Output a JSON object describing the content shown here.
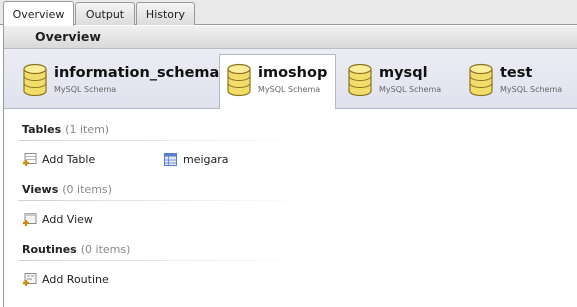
{
  "tabs": [
    {
      "label": "Overview",
      "active": true
    },
    {
      "label": "Output",
      "active": false
    },
    {
      "label": "History",
      "active": false
    }
  ],
  "overview": {
    "title": "Overview"
  },
  "schemas": [
    {
      "name": "information_schema",
      "kind": "MySQL Schema",
      "selected": false
    },
    {
      "name": "imoshop",
      "kind": "MySQL Schema",
      "selected": true
    },
    {
      "name": "mysql",
      "kind": "MySQL Schema",
      "selected": false
    },
    {
      "name": "test",
      "kind": "MySQL Schema",
      "selected": false
    }
  ],
  "groups": {
    "tables": {
      "title": "Tables",
      "count": "(1 item)",
      "add_label": "Add Table",
      "items": [
        "meigara"
      ]
    },
    "views": {
      "title": "Views",
      "count": "(0 items)",
      "add_label": "Add View"
    },
    "routines": {
      "title": "Routines",
      "count": "(0 items)",
      "add_label": "Add Routine"
    }
  },
  "icons": {
    "database": "database-cylinder-icon",
    "add_table": "add-table-icon",
    "table": "table-icon",
    "add_view": "add-view-icon",
    "add_routine": "add-routine-icon"
  },
  "colors": {
    "db_icon_fill": "#f3dd6a",
    "db_icon_stroke": "#8a7420",
    "add_plus": "#c98a12",
    "table_blue": "#5a7fc4"
  }
}
